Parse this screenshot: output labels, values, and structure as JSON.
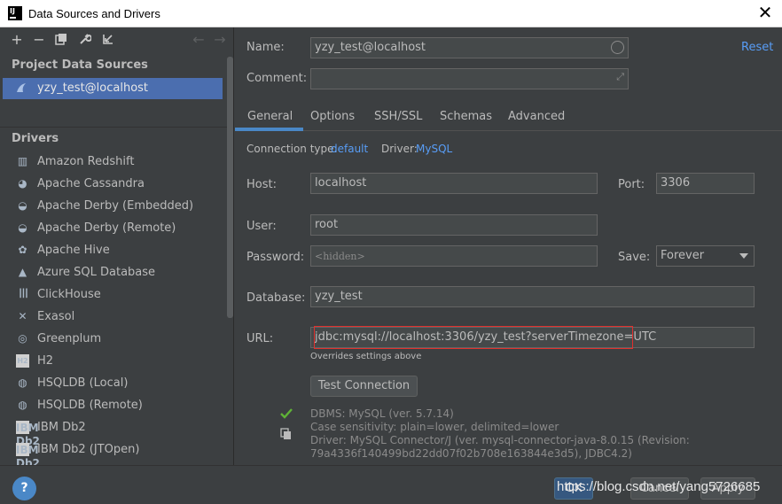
{
  "window": {
    "title": "Data Sources and Drivers",
    "icon_text": "IJ"
  },
  "left": {
    "toolbar": [
      "add-icon",
      "remove-icon",
      "duplicate-icon",
      "wrench-icon",
      "import-icon",
      "back-icon",
      "forward-icon"
    ],
    "project_title": "Project Data Sources",
    "project_items": [
      {
        "label": "yzy_test@localhost"
      }
    ],
    "drivers_title": "Drivers",
    "drivers": [
      {
        "label": "Amazon Redshift",
        "icon": "▥"
      },
      {
        "label": "Apache Cassandra",
        "icon": "◕"
      },
      {
        "label": "Apache Derby (Embedded)",
        "icon": "◒"
      },
      {
        "label": "Apache Derby (Remote)",
        "icon": "◒"
      },
      {
        "label": "Apache Hive",
        "icon": "✿"
      },
      {
        "label": "Azure SQL Database",
        "icon": "▲"
      },
      {
        "label": "ClickHouse",
        "icon": "┃┃┃"
      },
      {
        "label": "Exasol",
        "icon": "✕"
      },
      {
        "label": "Greenplum",
        "icon": "◎"
      },
      {
        "label": "H2",
        "icon": "H2"
      },
      {
        "label": "HSQLDB (Local)",
        "icon": "◍"
      },
      {
        "label": "HSQLDB (Remote)",
        "icon": "◍"
      },
      {
        "label": "IBM Db2",
        "icon": "IBM Db2"
      },
      {
        "label": "IBM Db2 (JTOpen)",
        "icon": "IBM Db2"
      }
    ]
  },
  "form": {
    "name_label": "Name:",
    "name_value": "yzy_test@localhost",
    "comment_label": "Comment:",
    "comment_value": "",
    "reset_label": "Reset",
    "tabs": [
      "General",
      "Options",
      "SSH/SSL",
      "Schemas",
      "Advanced"
    ],
    "conn_type_label": "Connection type:",
    "conn_type_value": "default",
    "driver_label": "Driver:",
    "driver_value": "MySQL",
    "host_label": "Host:",
    "host_value": "localhost",
    "port_label": "Port:",
    "port_value": "3306",
    "user_label": "User:",
    "user_value": "root",
    "password_label": "Password:",
    "password_value": "<hidden>",
    "save_label": "Save:",
    "save_value": "Forever",
    "database_label": "Database:",
    "database_value": "yzy_test",
    "url_label": "URL:",
    "url_value": "jdbc:mysql://localhost:3306/yzy_test?serverTimezone=UTC",
    "url_hint": "Overrides settings above",
    "test_button": "Test Connection",
    "info_lines": [
      "DBMS: MySQL (ver. 5.7.14)",
      "Case sensitivity: plain=lower, delimited=lower",
      "Driver: MySQL Connector/J (ver. mysql-connector-java-8.0.15 (Revision:",
      "79a4336f140499bd22dd07f02b708e163844e3d5), JDBC4.2)"
    ]
  },
  "bottom": {
    "help_label": "?",
    "ok_label": "OK",
    "cancel_label": "Cancel",
    "apply_label": "Apply",
    "watermark": "https://blog.csdn.net/yang5726685"
  },
  "colors": {
    "accent": "#4b6eaf",
    "link": "#589df6",
    "highlight_box": "#e0302d",
    "success": "#5fb336"
  }
}
